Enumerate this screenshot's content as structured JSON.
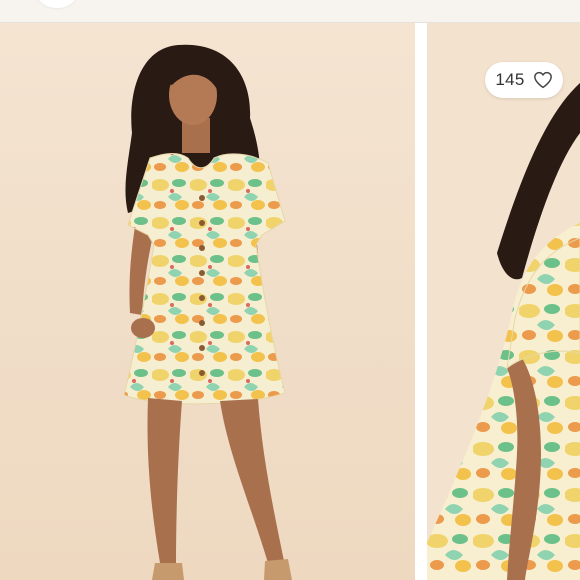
{
  "listing": {
    "like_count": "145",
    "like_icon": "heart-outline-icon"
  },
  "colors": {
    "backdrop": "#f1dfc9",
    "print_yellow": "#f1d36b",
    "print_green": "#6cc08a",
    "print_orange": "#ec9a4c",
    "skin": "#a9704e",
    "hair": "#2a1a14"
  }
}
